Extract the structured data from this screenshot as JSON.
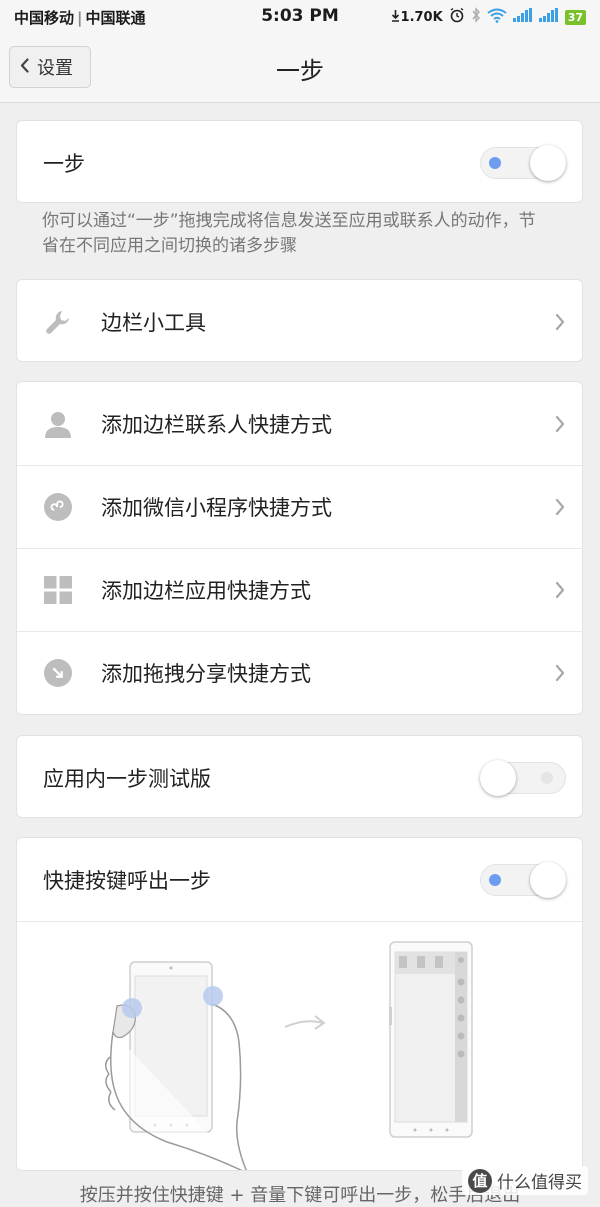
{
  "status_bar": {
    "carrier1": "中国移动",
    "carrier2": "中国联通",
    "time": "5:03 PM",
    "net_speed": "1.70K",
    "battery": "37"
  },
  "header": {
    "back_label": "设置",
    "title": "一步"
  },
  "main_toggle": {
    "label": "一步",
    "state": "on"
  },
  "description": "你可以通过“一步”拖拽完成将信息发送至应用或联系人的动作，节省在不同应用之间切换的诸多步骤",
  "sidebar_tools": {
    "label": "边栏小工具"
  },
  "shortcuts": [
    {
      "label": "添加边栏联系人快捷方式",
      "icon": "person-icon"
    },
    {
      "label": "添加微信小程序快捷方式",
      "icon": "mini-program-icon"
    },
    {
      "label": "添加边栏应用快捷方式",
      "icon": "app-grid-icon"
    },
    {
      "label": "添加拖拽分享快捷方式",
      "icon": "drag-share-icon"
    }
  ],
  "beta_toggle": {
    "label": "应用内一步测试版",
    "state": "off"
  },
  "hotkey_toggle": {
    "label": "快捷按键呼出一步",
    "state": "on"
  },
  "bottom_hint": "按压并按住快捷键 + 音量下键可呼出一步，松手后退出",
  "watermark": {
    "text": "什么值得买",
    "badge": "值"
  },
  "colors": {
    "toggle_on_dot": "#6e9df0",
    "battery": "#79c12b",
    "icon_gray": "#bdbdbd"
  }
}
